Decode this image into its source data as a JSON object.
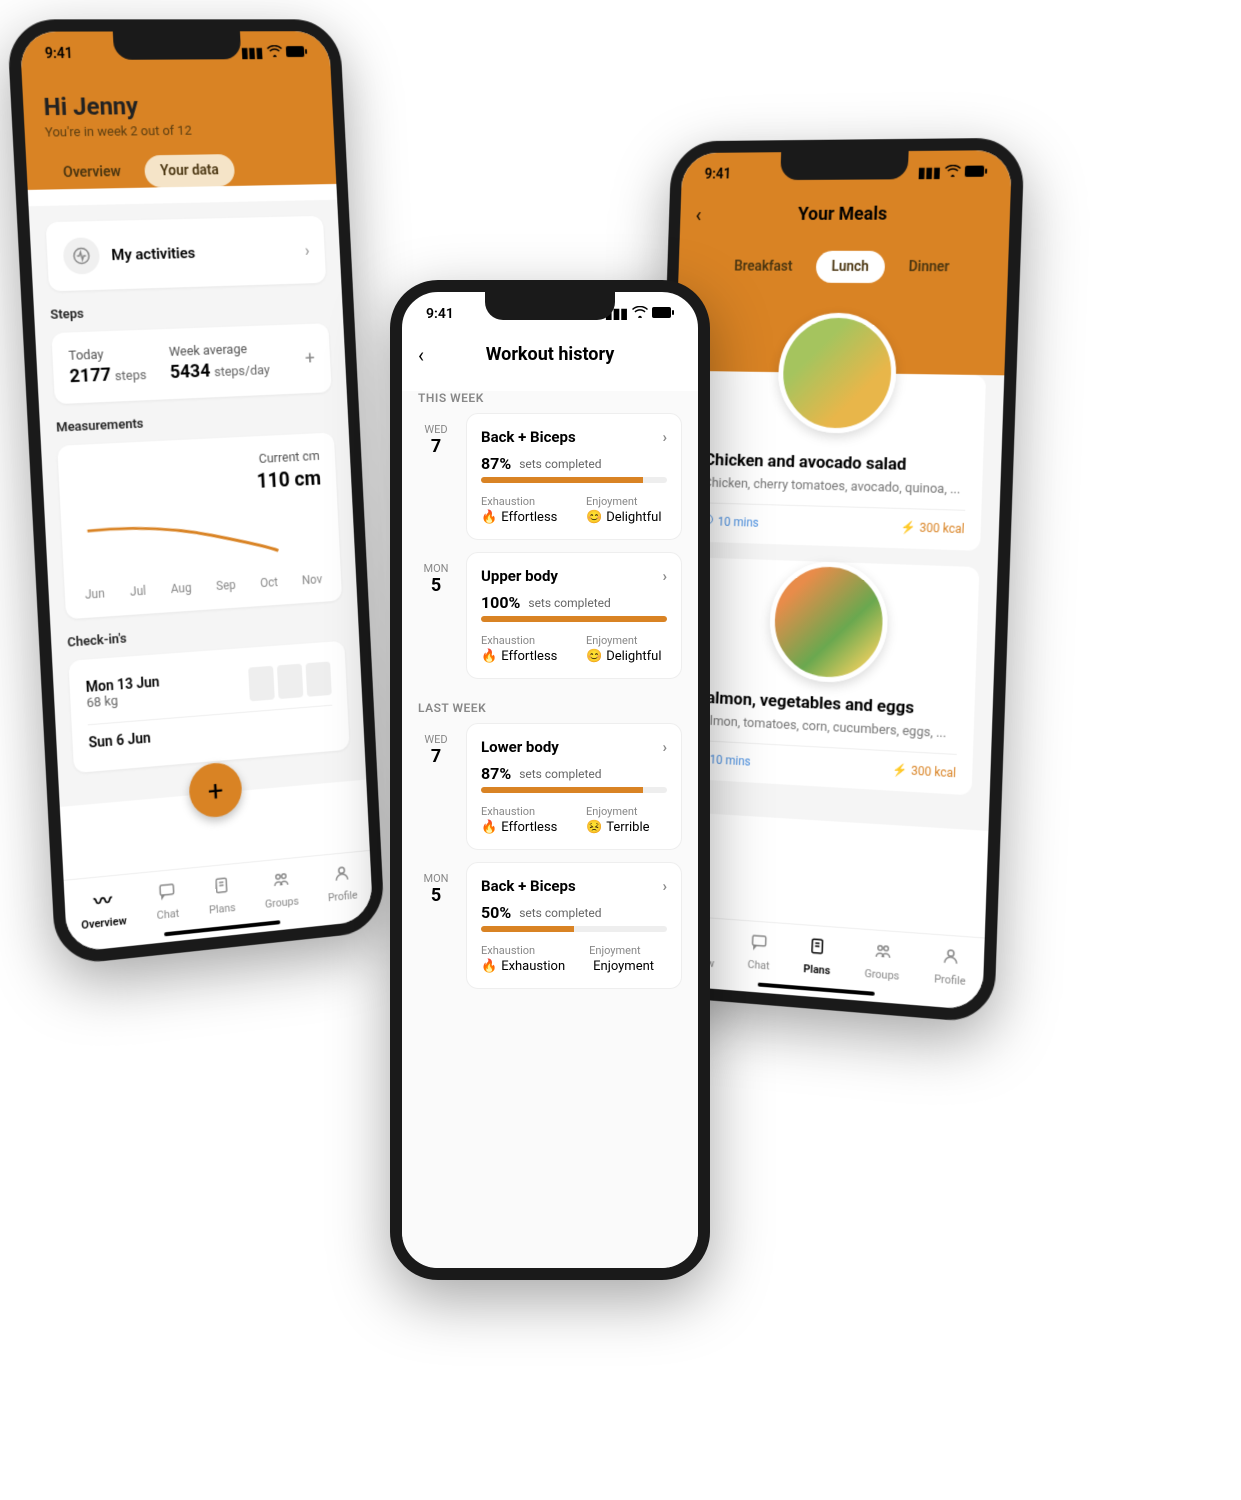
{
  "status_time": "9:41",
  "phone1": {
    "greeting": "Hi Jenny",
    "subtext": "You're in week 2 out of 12",
    "tabs": [
      "Overview",
      "Your data"
    ],
    "active_tab": "Your data",
    "activities_label": "My activities",
    "steps": {
      "section": "Steps",
      "today_label": "Today",
      "today_value": "2177",
      "today_unit": "steps",
      "avg_label": "Week average",
      "avg_value": "5434",
      "avg_unit": "steps/day"
    },
    "measurements": {
      "section": "Measurements",
      "current_label": "Current cm",
      "current_value": "110 cm",
      "months": [
        "Jun",
        "Jul",
        "Aug",
        "Sep",
        "Oct",
        "Nov"
      ]
    },
    "checkins": {
      "section": "Check-in's",
      "items": [
        {
          "date": "Mon 13 Jun",
          "weight": "68 kg"
        },
        {
          "date": "Sun 6 Jun",
          "weight": ""
        }
      ]
    },
    "nav": [
      "Overview",
      "Chat",
      "Plans",
      "Groups",
      "Profile"
    ],
    "nav_active": "Overview"
  },
  "phone2": {
    "title": "Workout history",
    "groups": [
      {
        "label": "THIS WEEK",
        "entries": [
          {
            "dow": "WED",
            "day": "7",
            "title": "Back + Biceps",
            "pct": "87%",
            "pct_num": 87,
            "label": "sets completed",
            "exhaustion": "Effortless",
            "enjoyment": "Delightful",
            "enjoy_emoji": "😊",
            "enjoy_color": "#f0a030"
          },
          {
            "dow": "MON",
            "day": "5",
            "title": "Upper body",
            "pct": "100%",
            "pct_num": 100,
            "label": "sets completed",
            "exhaustion": "Effortless",
            "enjoyment": "Delightful",
            "enjoy_emoji": "😊",
            "enjoy_color": "#f0a030"
          }
        ]
      },
      {
        "label": "LAST WEEK",
        "entries": [
          {
            "dow": "WED",
            "day": "7",
            "title": "Lower body",
            "pct": "87%",
            "pct_num": 87,
            "label": "sets completed",
            "exhaustion": "Effortless",
            "enjoyment": "Terrible",
            "enjoy_emoji": "😣",
            "enjoy_color": "#e0a030"
          },
          {
            "dow": "MON",
            "day": "5",
            "title": "Back + Biceps",
            "pct": "50%",
            "pct_num": 50,
            "label": "sets completed",
            "exhaustion": "Exhaustion",
            "enjoyment": "Enjoyment",
            "enjoy_emoji": "",
            "enjoy_color": "#888"
          }
        ]
      }
    ],
    "exhaustion_label": "Exhaustion",
    "enjoyment_label": "Enjoyment"
  },
  "phone3": {
    "title": "Your Meals",
    "tabs": [
      "Breakfast",
      "Lunch",
      "Dinner"
    ],
    "active_tab": "Lunch",
    "meals": [
      {
        "name": "Chicken and avocado salad",
        "desc": "Chicken, cherry tomatoes, avocado, quinoa, ...",
        "time": "10 mins",
        "kcal": "300 kcal"
      },
      {
        "name": "Salmon, vegetables and eggs",
        "desc": "Salmon, tomatoes, corn, cucumbers, eggs, ...",
        "time": "10 mins",
        "kcal": "300 kcal"
      }
    ],
    "nav": [
      "Overview",
      "Chat",
      "Plans",
      "Groups",
      "Profile"
    ],
    "nav_active": "Plans"
  },
  "chart_data": {
    "type": "line",
    "categories": [
      "Jun",
      "Jul",
      "Aug",
      "Sep",
      "Oct",
      "Nov"
    ],
    "values": [
      118,
      117,
      115,
      113,
      110,
      null
    ],
    "title": "Measurements",
    "ylabel": "cm",
    "current": 110
  }
}
